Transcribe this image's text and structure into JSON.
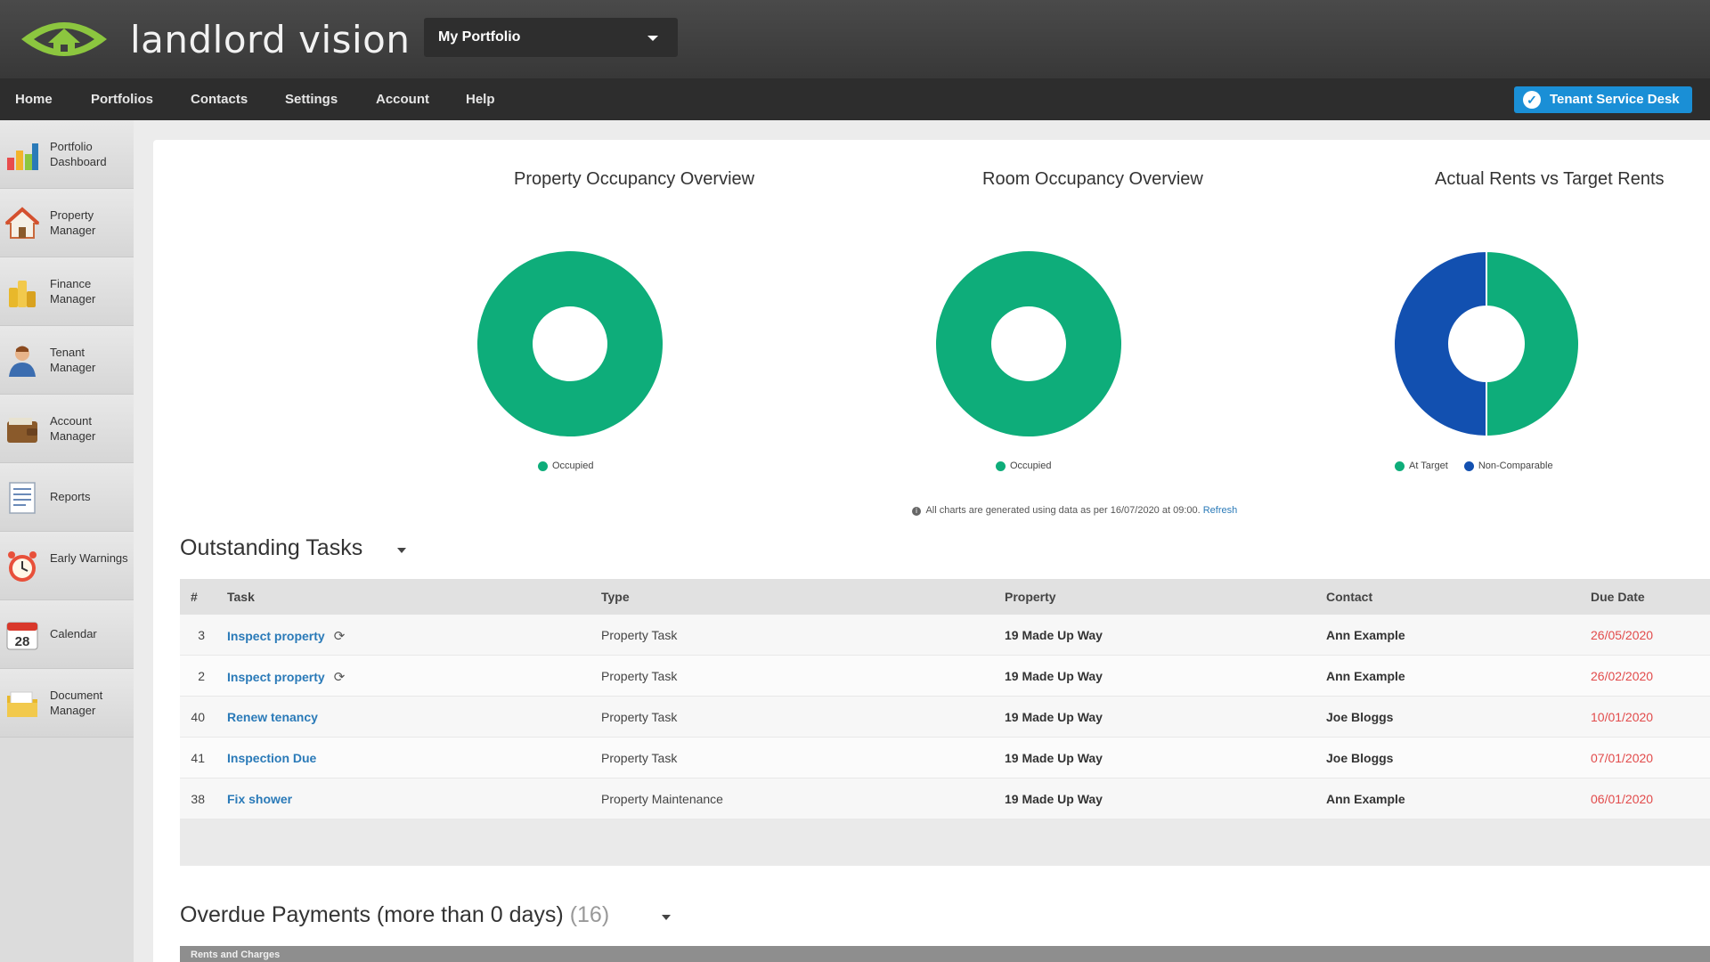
{
  "header": {
    "brand": "landlord vision",
    "portfolio_selector": "My Portfolio"
  },
  "nav": {
    "items": [
      "Home",
      "Portfolios",
      "Contacts",
      "Settings",
      "Account",
      "Help"
    ],
    "tenant_service_desk": "Tenant Service Desk"
  },
  "sidebar": {
    "items": [
      {
        "label": "Portfolio Dashboard",
        "icon": "bar-chart-icon"
      },
      {
        "label": "Property Manager",
        "icon": "house-icon"
      },
      {
        "label": "Finance Manager",
        "icon": "coins-icon"
      },
      {
        "label": "Tenant Manager",
        "icon": "person-icon"
      },
      {
        "label": "Account Manager",
        "icon": "wallet-icon"
      },
      {
        "label": "Reports",
        "icon": "document-icon"
      },
      {
        "label": "Early Warnings",
        "icon": "alarm-clock-icon"
      },
      {
        "label": "Calendar",
        "icon": "calendar-icon"
      },
      {
        "label": "Document Manager",
        "icon": "folder-icon"
      }
    ],
    "calendar_day": "28"
  },
  "chart_data": [
    {
      "type": "pie",
      "title": "Property Occupancy Overview",
      "slices": [
        {
          "label": "Occupied",
          "value": 100
        }
      ],
      "colors": [
        "#0ead7a"
      ],
      "legend": "bottom"
    },
    {
      "type": "pie",
      "title": "Room Occupancy Overview",
      "slices": [
        {
          "label": "Occupied",
          "value": 100
        }
      ],
      "colors": [
        "#0ead7a"
      ],
      "legend": "bottom"
    },
    {
      "type": "pie",
      "title": "Actual Rents vs Target Rents",
      "slices": [
        {
          "label": "At Target",
          "value": 50
        },
        {
          "label": "Non-Comparable",
          "value": 50
        }
      ],
      "colors": [
        "#0ead7a",
        "#1250b0"
      ],
      "legend": "bottom"
    }
  ],
  "charts_note": {
    "text": "All charts are generated using data as per 16/07/2020 at 09:00.",
    "refresh": "Refresh"
  },
  "tasks": {
    "title": "Outstanding Tasks",
    "columns": [
      "#",
      "Task",
      "Type",
      "Property",
      "Contact",
      "Due Date"
    ],
    "rows": [
      {
        "id": "3",
        "task": "Inspect property",
        "recurring": true,
        "type": "Property Task",
        "property": "19 Made Up Way",
        "contact": "Ann Example",
        "due": "26/05/2020"
      },
      {
        "id": "2",
        "task": "Inspect property",
        "recurring": true,
        "type": "Property Task",
        "property": "19 Made Up Way",
        "contact": "Ann Example",
        "due": "26/02/2020"
      },
      {
        "id": "40",
        "task": "Renew tenancy",
        "recurring": false,
        "type": "Property Task",
        "property": "19 Made Up Way",
        "contact": "Joe Bloggs",
        "due": "10/01/2020"
      },
      {
        "id": "41",
        "task": "Inspection Due",
        "recurring": false,
        "type": "Property Task",
        "property": "19 Made Up Way",
        "contact": "Joe Bloggs",
        "due": "07/01/2020"
      },
      {
        "id": "38",
        "task": "Fix shower",
        "recurring": false,
        "type": "Property Maintenance",
        "property": "19 Made Up Way",
        "contact": "Ann Example",
        "due": "06/01/2020"
      }
    ]
  },
  "overdue": {
    "title": "Overdue Payments (more than 0 days)",
    "count": "(16)",
    "bar_label": "Rents and Charges"
  }
}
